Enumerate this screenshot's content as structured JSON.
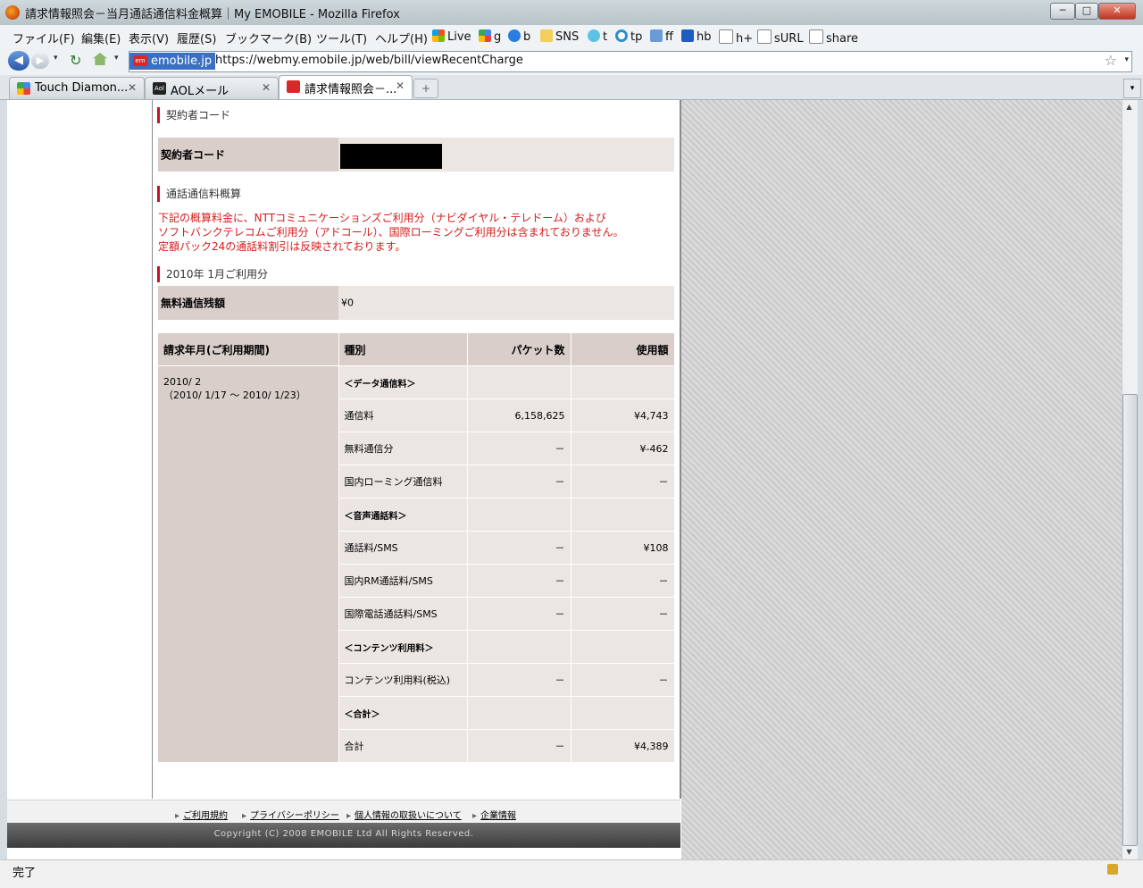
{
  "window": {
    "title": "請求情報照会－当月通話通信料金概算｜My EMOBILE - Mozilla Firefox",
    "minimize": "─",
    "maximize": "□",
    "close": "✕"
  },
  "menu": [
    "ファイル(F)",
    "編集(E)",
    "表示(V)",
    "履歴(S)",
    "ブックマーク(B)",
    "ツール(T)",
    "ヘルプ(H)"
  ],
  "bookmarks": [
    "Live",
    "g",
    "b",
    "SNS",
    "t",
    "tp",
    "ff",
    "hb",
    "h+",
    "sURL",
    "share"
  ],
  "nav": {
    "site_badge": "emobile.jp",
    "url": "https://webmy.emobile.jp/web/bill/viewRecentCharge",
    "em_logo": "em"
  },
  "tabs": [
    {
      "label": "Touch Diamon...",
      "close": "✕"
    },
    {
      "label": "AOLメール",
      "close": "✕"
    },
    {
      "label": "請求情報照会－...",
      "close": "✕"
    }
  ],
  "tab_new": "+",
  "page": {
    "sec_contract": "契約者コード",
    "contract_label": "契約者コード",
    "sec_estimate": "通話通信料概算",
    "notice": [
      "下記の概算料金に、NTTコミュニケーションズご利用分（ナビダイヤル・テレドーム）および",
      "ソフトバンクテレコムご利用分（アドコール）、国際ローミングご利用分は含まれておりません。",
      "定額パック24の通話料割引は反映されております。"
    ],
    "sec_month": "2010年 1月ご利用分",
    "free_label": "無料通信残額",
    "free_value": "¥0",
    "table": {
      "headers": [
        "請求年月(ご利用期間)",
        "種別",
        "パケット数",
        "使用額"
      ],
      "period_line1": "2010/ 2",
      "period_line2": "（2010/ 1/17 ～ 2010/ 1/23）",
      "rows": [
        {
          "type": "＜データ通信料＞",
          "packets": "",
          "amount": "",
          "group": true
        },
        {
          "type": "通信料",
          "packets": "6,158,625",
          "amount": "¥4,743"
        },
        {
          "type": "無料通信分",
          "packets": "－",
          "amount": "¥-462"
        },
        {
          "type": "国内ローミング通信料",
          "packets": "－",
          "amount": "－"
        },
        {
          "type": "＜音声通話料＞",
          "packets": "",
          "amount": "",
          "group": true
        },
        {
          "type": "通話料/SMS",
          "packets": "－",
          "amount": "¥108"
        },
        {
          "type": "国内RM通話料/SMS",
          "packets": "－",
          "amount": "－"
        },
        {
          "type": "国際電話通話料/SMS",
          "packets": "－",
          "amount": "－"
        },
        {
          "type": "＜コンテンツ利用料＞",
          "packets": "",
          "amount": "",
          "group": true
        },
        {
          "type": "コンテンツ利用料(税込)",
          "packets": "－",
          "amount": "－"
        },
        {
          "type": "＜合計＞",
          "packets": "",
          "amount": "",
          "group": true
        },
        {
          "type": "合計",
          "packets": "－",
          "amount": "¥4,389"
        }
      ]
    },
    "footer_links": [
      "ご利用規約",
      "プライバシーポリシー",
      "個人情報の取扱いについて",
      "企業情報"
    ],
    "copyright": "Copyright (C) 2008 EMOBILE Ltd All Rights Reserved."
  },
  "status": "完了",
  "colors": {
    "accent_red": "#c8102e",
    "notice_red": "#d61b1b",
    "header_bg": "#d9ceca",
    "row_bg": "#ebe6e2"
  }
}
